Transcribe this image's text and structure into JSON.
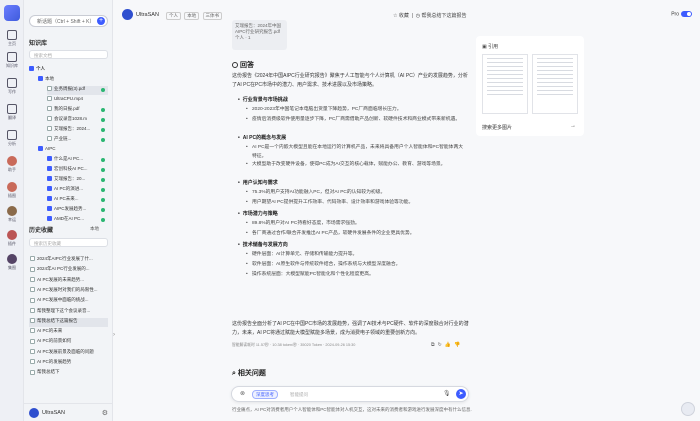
{
  "rail": {
    "items": [
      {
        "label": "主页",
        "icon": "home-icon"
      },
      {
        "label": "知识库",
        "icon": "book-icon"
      },
      {
        "label": "写作",
        "icon": "pen-icon"
      },
      {
        "label": "翻译",
        "icon": "translate-icon"
      },
      {
        "label": "分析",
        "icon": "chart-icon"
      },
      {
        "label": "助手",
        "icon": "bot-icon"
      },
      {
        "label": "插图",
        "icon": "image-icon"
      },
      {
        "label": "幸运",
        "icon": "avatar-icon"
      },
      {
        "label": "插件",
        "icon": "avatar-icon"
      },
      {
        "label": "集图",
        "icon": "avatar-icon"
      }
    ]
  },
  "sidebar": {
    "new_chat_label": "新话题（Ctrl + Shift + K）",
    "kb_title": "知识库",
    "kb_search_placeholder": "搜索文档",
    "tree": [
      {
        "label": "个人",
        "level": 0,
        "checked": true,
        "bold": true
      },
      {
        "label": "本地",
        "level": 1,
        "checked": true
      },
      {
        "label": "业务周报(3).pdf",
        "level": 2,
        "checked": false,
        "selected": true,
        "status": true
      },
      {
        "label": "UltraCPU.mp4",
        "level": 2,
        "checked": false
      },
      {
        "label": "我的日报.pdf",
        "level": 2,
        "checked": false,
        "status": true
      },
      {
        "label": "会议录音1028.m",
        "level": 2,
        "checked": false,
        "status": true
      },
      {
        "label": "艾瑞报告：2024...",
        "level": 2,
        "checked": false,
        "status": true
      },
      {
        "label": "产业链...",
        "level": 2,
        "checked": false,
        "status": true
      },
      {
        "label": "AIPC",
        "level": 1,
        "checked": true
      },
      {
        "label": "什么是AI PC...",
        "level": 2,
        "checked": true,
        "status": true
      },
      {
        "label": "宏创科技AI PC...",
        "level": 2,
        "checked": true,
        "status": true
      },
      {
        "label": "艾瑞报告：20...",
        "level": 2,
        "checked": true,
        "status": true
      },
      {
        "label": "AI PC的演进...",
        "level": 2,
        "checked": true,
        "status": true
      },
      {
        "label": "AI PC未来...",
        "level": 2,
        "checked": true,
        "status": true
      },
      {
        "label": "AIPC发展趋势...",
        "level": 2,
        "checked": true,
        "status": true
      },
      {
        "label": "AMD在AI PC...",
        "level": 2,
        "checked": true,
        "status": true
      }
    ],
    "history_title": "历史收藏",
    "history_filter": "本地",
    "history_search_placeholder": "搜索历史收藏",
    "history": [
      {
        "label": "2024年AIPC行业发展了什..."
      },
      {
        "label": "2024年AI PC行业发展的..."
      },
      {
        "label": "AI PC发展的未来趋势..."
      },
      {
        "label": "AI PC发展时对我们的局限性..."
      },
      {
        "label": "AI PC发展中面临的挑战..."
      },
      {
        "label": "帮我整理下这个会议录音..."
      },
      {
        "label": "帮我总结下这篇报告",
        "selected": true
      },
      {
        "label": "AI PC的未来"
      },
      {
        "label": "AI PC的前景如何"
      },
      {
        "label": "AI PC发展前景及面临的问题"
      },
      {
        "label": "AI PC的发展趋势"
      },
      {
        "label": "帮我总结下"
      }
    ],
    "user_name": "UltraSAN"
  },
  "topbar": {
    "user_name": "UltraSAN",
    "tags": [
      "个人",
      "本地",
      "三体书"
    ],
    "fav_label": "收藏",
    "session_title": "帮我总结下这篇报告",
    "pro_label": "Pro"
  },
  "main": {
    "ref_card_text": "艾瑞报告：2024年中国AIPC行业研究报告.pdf 个人 · 1",
    "answer_title": "回答",
    "intro": "这份报告《2024年中国AIPC行业研究报告》聚焦于人工智能与个人计算机（AI PC）产业的发展趋势，分析了AI PC在PC市场中的潜力、用户需求、技术进展以及市场策略。",
    "sections": [
      {
        "heading": "行业背景与市场挑战",
        "items": [
          "2020-2023年中国笔记本电脑出货量下降趋势，PC厂商面临增长压力。",
          "疫情后消费级软件使用量逐步下降，PC厂商需借助产品创新、软硬件技术和商业模式带来新机遇。"
        ]
      },
      {
        "heading": "AI PC的概念与发展",
        "items": [
          "AI PC是一个内嵌大模型且能在本地运行的计算机产品，未来将具备用户个人智能体和PC智能体两大特征。",
          "大模型助于改变硬件设备，使得PC成为AI交互的核心载体，赋能办公、教育、游戏等场景。"
        ]
      },
      {
        "heading": "用户认知与需求",
        "items": [
          "75.3%的用户支持AI功能融入PC，但对AI PC的认知较为初级。",
          "用户期望AI PC提供提升工作效率、代码效率、设计效率和游戏体验等功能。"
        ]
      },
      {
        "heading": "市场潜力与策略",
        "items": [
          "89.8%的用户对AI PC持看好态度，市场需求强劲。",
          "各厂商通过合作/联合开发推出AI PC产品，软硬件发展条件的企业更具优势。"
        ]
      },
      {
        "heading": "技术储备与发展方向",
        "items": [
          "硬件层面：AI计算单元、存储和传输能力提升等。",
          "软件层面：AI原生软件与传统软件结合，操作系统与大模型深度融合。",
          "操作系统层面：大模型赋能PC智能化和个性化程度更高。"
        ]
      }
    ],
    "conclusion": "这份报告全面分析了AI PC在中国PC市场的发展趋势，强调了AI技术与PC硬件、软件的深度融合对行业的潜力，未来，AI PC将通过赋能大模型赋能多场景，成为消费电子领域的重要创新方向。",
    "meta": "智能解读耗时 11.57秒 · 10.38 token/秒 · 35020 Token · 2024-09-26 15:30",
    "related_title": "相关问题",
    "related_item": "行业痛点，AI PC对消费者用户个人智能体和PC智能体对人机交互，这对未来的消费者和游戏进行发展深度中有什么信息..."
  },
  "input": {
    "mode_label": "深度思考",
    "placeholder": "智能提问"
  },
  "right_panel": {
    "title": "引用",
    "more_label": "搜索更多图片"
  }
}
